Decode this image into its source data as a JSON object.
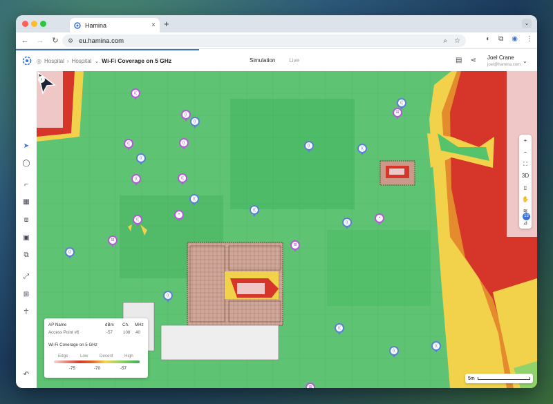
{
  "browser": {
    "tab_title": "Hamina",
    "url": "eu.hamina.com",
    "new_tab_label": "+",
    "tab_close": "×"
  },
  "app": {
    "breadcrumbs": [
      "Hospital",
      "Hospital"
    ],
    "current_page": "Wi-Fi Coverage on 5 GHz",
    "modes": {
      "simulation": "Simulation",
      "live": "Live"
    },
    "user": {
      "name": "Joel Crane",
      "email": "joel@hamina.com"
    }
  },
  "map": {
    "layers_badge": "13",
    "controls": [
      "+",
      "−",
      "⛶",
      "3D",
      "▯",
      "✋",
      "≋",
      "⊿"
    ],
    "scale_label": "5m"
  },
  "ap_panel": {
    "headers": [
      "AP Name",
      "dBm",
      "Ch.",
      "MHz"
    ],
    "row": [
      "Access Point #6",
      "-57",
      "108",
      "40"
    ],
    "legend_title": "Wi-Fi Coverage on 5 GHz",
    "legend_labels": [
      "Edge",
      "Low",
      "Decent",
      "High"
    ],
    "legend_values": [
      "-75",
      "-70",
      "-57"
    ]
  },
  "colors": {
    "high": "#4cbf6a",
    "decent": "#f2d24a",
    "low": "#d6352a",
    "accent": "#3b6fd8"
  }
}
